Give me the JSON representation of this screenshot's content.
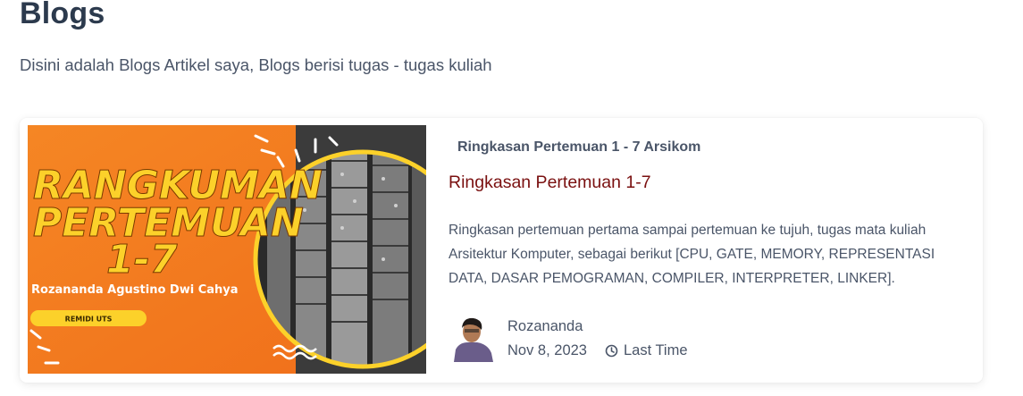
{
  "header": {
    "title": "Blogs",
    "subtitle": "Disini adalah Blogs Artikel saya, Blogs berisi tugas - tugas kuliah"
  },
  "post": {
    "category": "Ringkasan Pertemuan 1 - 7 Arsikom",
    "title": "Ringkasan Pertemuan 1-7",
    "excerpt": "Ringkasan pertemuan pertama sampai pertemuan ke tujuh, tugas mata kuliah Arsitektur Komputer, sebagai berikut [CPU, GATE, MEMORY, REPRESENTASI DATA, DASAR PEMOGRAMAN, COMPILER, INTERPRETER, LINKER].",
    "author": "Rozananda",
    "date": "Nov 8, 2023",
    "reading_time": "Last Time",
    "thumbnail": {
      "headline_line1": "RANGKUMAN",
      "headline_line2": "PERTEMUAN",
      "headline_line3": "1-7",
      "name": "Rozananda Agustino Dwi Cahya",
      "badge": "REMIDI UTS"
    }
  },
  "colors": {
    "title": "#2c3a4d",
    "post_title": "#7a1010",
    "thumb_orange": "#f47a20",
    "thumb_yellow": "#fcd12a"
  }
}
